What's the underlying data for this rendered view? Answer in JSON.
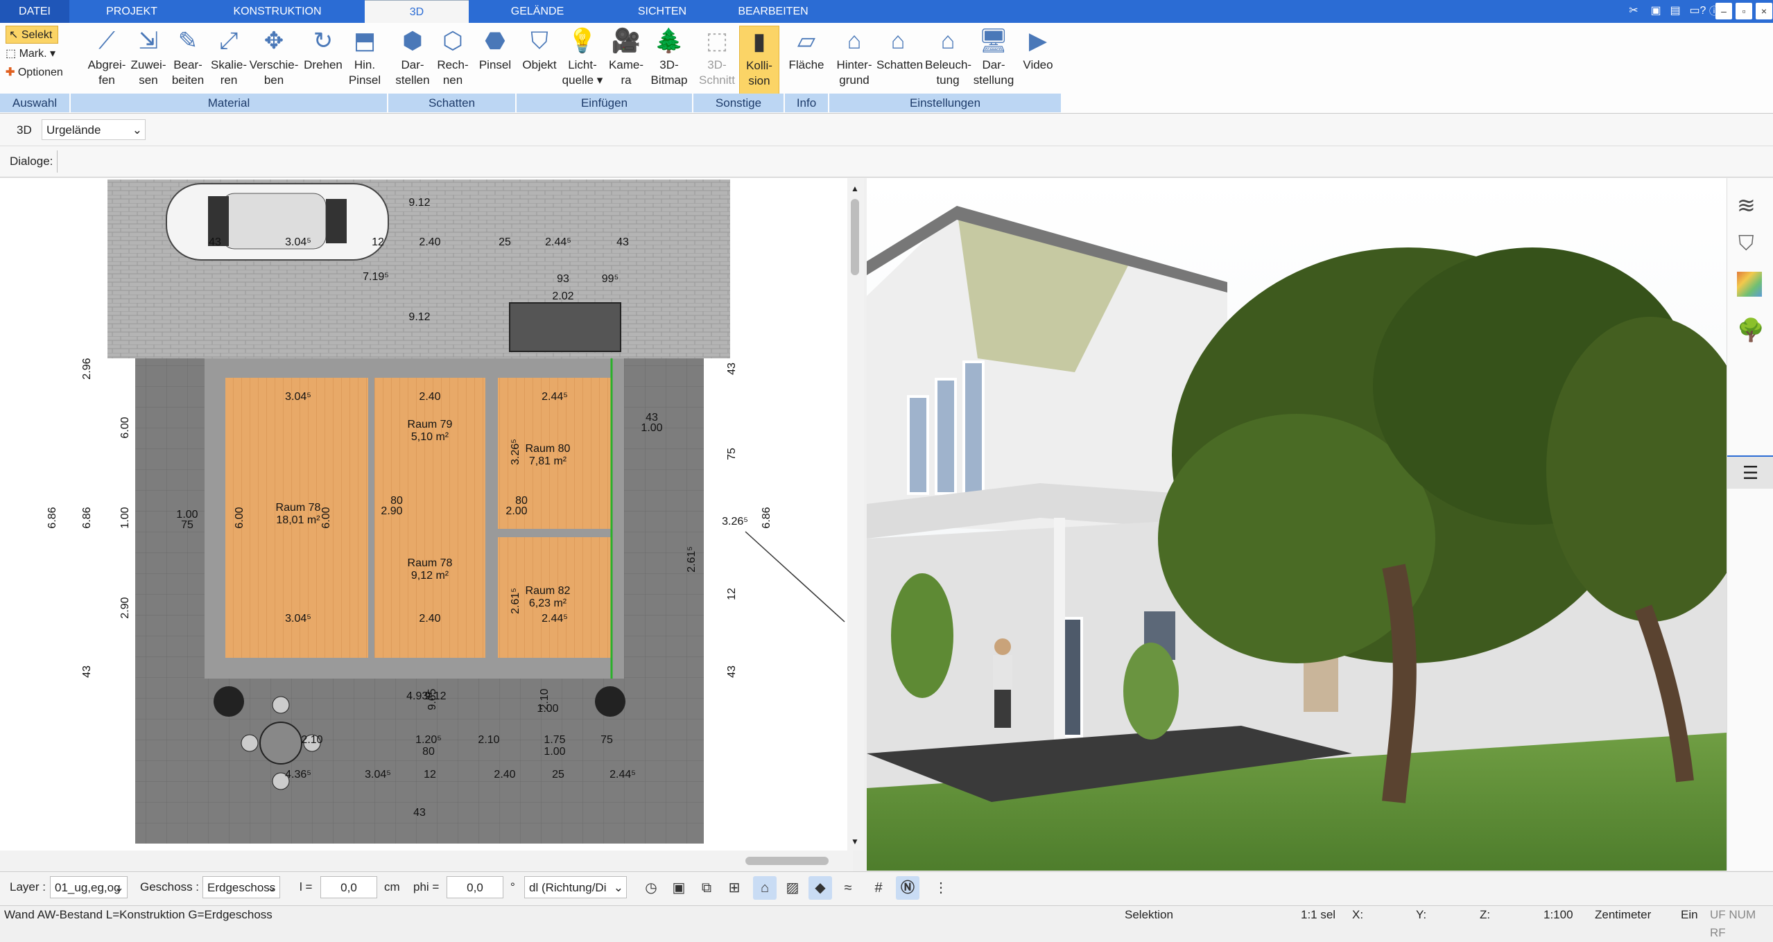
{
  "tabs": [
    "DATEI",
    "PROJEKT",
    "KONSTRUKTION",
    "3D",
    "GELÄNDE",
    "SICHTEN",
    "BEARBEITEN"
  ],
  "window_controls": [
    "–",
    "▫",
    "×"
  ],
  "ribbon": {
    "selection": {
      "select": "Selekt",
      "mark": "Mark.",
      "options": "Optionen"
    },
    "buttons": [
      {
        "l1": "Abgrei-",
        "l2": "fen"
      },
      {
        "l1": "Zuwei-",
        "l2": "sen"
      },
      {
        "l1": "Bear-",
        "l2": "beiten"
      },
      {
        "l1": "Skalie-",
        "l2": "ren"
      },
      {
        "l1": "Verschie-",
        "l2": "ben"
      },
      {
        "l1": "Drehen",
        "l2": ""
      },
      {
        "l1": "Hin.",
        "l2": "Pinsel"
      },
      {
        "l1": "Dar-",
        "l2": "stellen"
      },
      {
        "l1": "Rech-",
        "l2": "nen"
      },
      {
        "l1": "Pinsel",
        "l2": ""
      },
      {
        "l1": "Objekt",
        "l2": ""
      },
      {
        "l1": "Licht-",
        "l2": "quelle ▾"
      },
      {
        "l1": "Kame-",
        "l2": "ra"
      },
      {
        "l1": "3D-",
        "l2": "Bitmap"
      },
      {
        "l1": "3D-",
        "l2": "Schnitt"
      },
      {
        "l1": "Kolli-",
        "l2": "sion"
      },
      {
        "l1": "Fläche",
        "l2": ""
      },
      {
        "l1": "Hinter-",
        "l2": "grund"
      },
      {
        "l1": "Schatten",
        "l2": ""
      },
      {
        "l1": "Beleuch-",
        "l2": "tung"
      },
      {
        "l1": "Dar-",
        "l2": "stellung"
      },
      {
        "l1": "Video",
        "l2": ""
      }
    ],
    "groups": [
      "Auswahl",
      "Material",
      "Schatten",
      "Einfügen",
      "Sonstige",
      "Info",
      "Einstellungen"
    ]
  },
  "row2": {
    "mode": "3D",
    "terrain": "Urgelände"
  },
  "row3": {
    "dialogs": "Dialoge:"
  },
  "plan": {
    "dims": [
      "9.12",
      "3.04⁵",
      "2.40",
      "25",
      "2.44⁵",
      "43",
      "93",
      "99⁵",
      "7.19⁵",
      "2.02",
      "9.12",
      "12",
      "43"
    ],
    "rooms": [
      {
        "name": "Raum 78",
        "area": "18,01 m²"
      },
      {
        "name": "Raum 79",
        "area": "5,10 m²"
      },
      {
        "name": "Raum 80",
        "area": "7,81 m²"
      },
      {
        "name": "Raum 78",
        "area": "9,12 m²"
      },
      {
        "name": "Raum 82",
        "area": "6,23 m²"
      }
    ],
    "inner_dims": [
      "3.04⁵",
      "2.40",
      "2.44⁵",
      "3.04⁵",
      "2.40",
      "2.44⁵",
      "6.00",
      "6.00",
      "3.26⁵",
      "2.61⁵",
      "80",
      "2.90",
      "80",
      "2.00",
      "1.00",
      "75",
      "1.00",
      "6.86",
      "6.86",
      "6.86",
      "6.00",
      "2.90",
      "2.96",
      "43",
      "43",
      "43",
      "43",
      "1.00",
      "75",
      "3.26⁵",
      "12",
      "2.61⁵",
      "4.93⁵",
      "9.65",
      "2.10",
      "1.75",
      "1.00",
      "75",
      "1.20⁵",
      "80",
      "2.10",
      "4.36⁵",
      "3.04⁵",
      "12",
      "2.40",
      "25",
      "2.44⁵",
      "43",
      "9.12",
      "2.10",
      "1.00",
      "75"
    ]
  },
  "tools": {
    "layer_label": "Layer :",
    "layer_value": "01_ug,eg,og",
    "geschoss_label": "Geschoss :",
    "geschoss_value": "Erdgeschoss",
    "l_label": "l =",
    "l_value": "0,0",
    "l_unit": "cm",
    "phi_label": "phi =",
    "phi_value": "0,0",
    "phi_unit": "°",
    "dl_value": "dl (Richtung/Di"
  },
  "status": {
    "left": "Wand AW-Bestand L=Konstruktion G=Erdgeschoss",
    "mode": "Selektion",
    "sel": "1:1 sel",
    "x": "X:",
    "y": "Y:",
    "z": "Z:",
    "scale": "1:100",
    "unit": "Zentimeter",
    "ein": "Ein",
    "flags": "UF NUM RF"
  },
  "colors": {
    "tab": "#2b6cd4",
    "group": "#bcd6f3",
    "active_button": "#fbd466",
    "floor": "#e8a968",
    "paving": "#8a8a8a"
  }
}
